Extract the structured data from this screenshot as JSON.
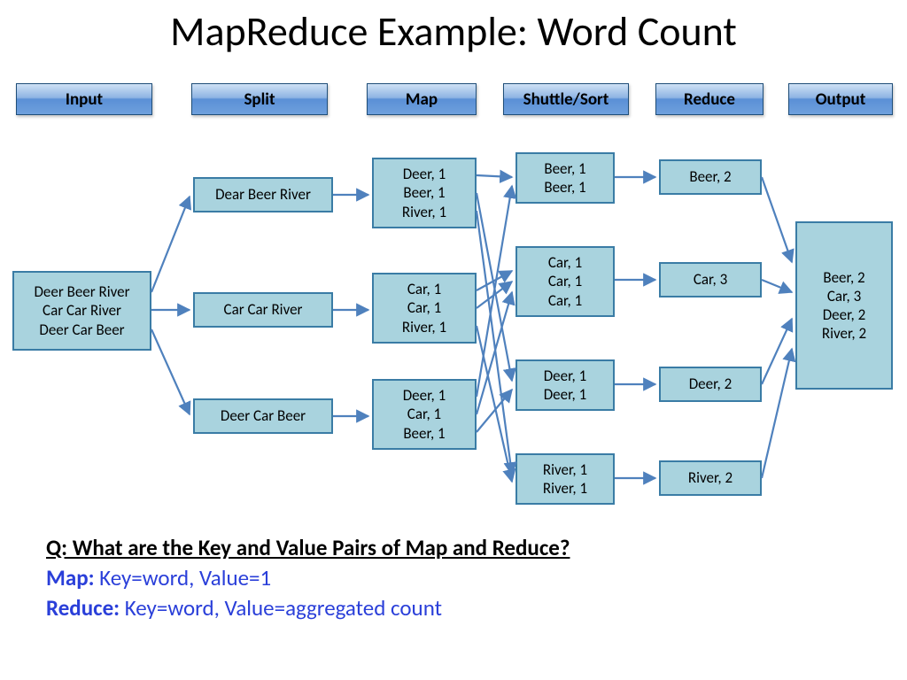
{
  "title": "MapReduce Example: Word Count",
  "stages": {
    "input": {
      "label": "Input"
    },
    "split": {
      "label": "Split"
    },
    "map": {
      "label": "Map"
    },
    "shuttle": {
      "label": "Shuttle/Sort"
    },
    "reduce": {
      "label": "Reduce"
    },
    "output": {
      "label": "Output"
    }
  },
  "nodes": {
    "input0": "Deer Beer River\nCar Car River\nDeer Car Beer",
    "split0": "Dear Beer River",
    "split1": "Car Car River",
    "split2": "Deer Car Beer",
    "map0": "Deer, 1\nBeer, 1\nRiver, 1",
    "map1": "Car, 1\nCar, 1\nRiver, 1",
    "map2": "Deer, 1\nCar, 1\nBeer, 1",
    "shuttle0": "Beer, 1\nBeer, 1",
    "shuttle1": "Car, 1\nCar, 1\nCar, 1",
    "shuttle2": "Deer, 1\nDeer, 1",
    "shuttle3": "River, 1\nRiver, 1",
    "reduce0": "Beer, 2",
    "reduce1": "Car, 3",
    "reduce2": "Deer, 2",
    "reduce3": "River, 2",
    "output0": "Beer, 2\nCar, 3\nDeer, 2\nRiver, 2"
  },
  "qa": {
    "question": "Q: What are the Key and Value Pairs of Map and Reduce?",
    "map_label": "Map:",
    "map_ans": " Key=word, Value=1",
    "reduce_label": "Reduce:",
    "reduce_ans": " Key=word, Value=aggregated count"
  },
  "colors": {
    "header_blue": "#5a8fd6",
    "node_fill": "#a9d3de",
    "node_border": "#3a7ca5",
    "arrow": "#4f81bd"
  }
}
